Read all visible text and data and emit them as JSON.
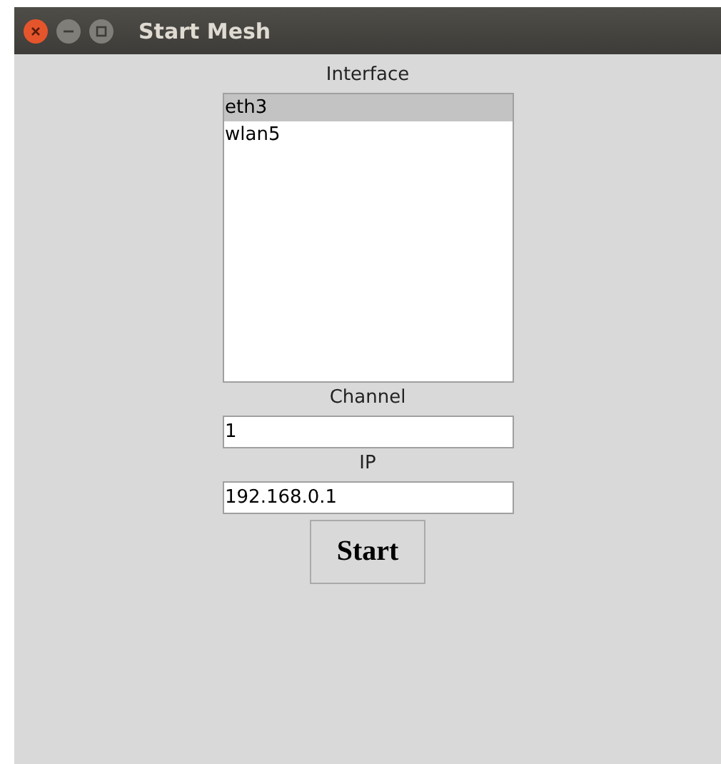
{
  "window": {
    "title": "Start Mesh"
  },
  "interface": {
    "label": "Interface",
    "items": [
      {
        "name": "eth3",
        "selected": true
      },
      {
        "name": "wlan5",
        "selected": false
      }
    ]
  },
  "channel": {
    "label": "Channel",
    "value": "1"
  },
  "ip": {
    "label": "IP",
    "value": "192.168.0.1"
  },
  "start_button": "Start"
}
